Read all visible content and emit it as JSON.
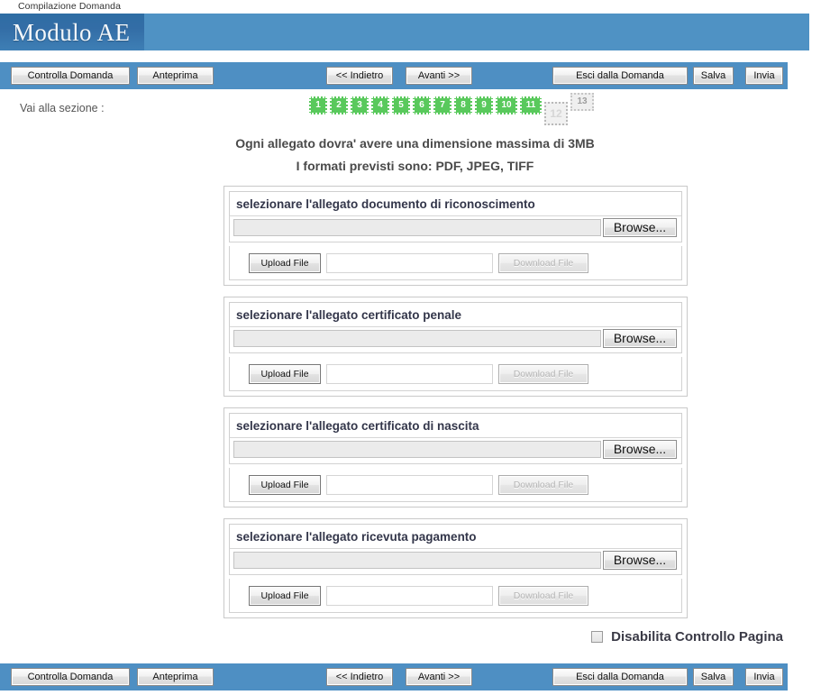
{
  "page": {
    "document_title": "Compilazione Domanda",
    "banner_title": "Modulo AE"
  },
  "toolbar": {
    "controlla_label": "Controlla Domanda",
    "anteprima_label": "Anteprima",
    "indietro_label": "<< Indietro",
    "avanti_label": "Avanti >>",
    "esci_label": "Esci dalla Domanda",
    "salva_label": "Salva",
    "invia_label": "Invia"
  },
  "section_nav": {
    "label": "Vai alla sezione :",
    "items": [
      {
        "number": "1",
        "state": "available"
      },
      {
        "number": "2",
        "state": "available"
      },
      {
        "number": "3",
        "state": "available"
      },
      {
        "number": "4",
        "state": "available"
      },
      {
        "number": "5",
        "state": "available"
      },
      {
        "number": "6",
        "state": "available"
      },
      {
        "number": "7",
        "state": "available"
      },
      {
        "number": "8",
        "state": "available"
      },
      {
        "number": "9",
        "state": "available"
      },
      {
        "number": "10",
        "state": "available"
      },
      {
        "number": "11",
        "state": "available"
      },
      {
        "number": "12",
        "state": "current"
      },
      {
        "number": "13",
        "state": "next"
      }
    ],
    "green": "#59c95c"
  },
  "info": {
    "line1": "Ogni allegato dovra' avere una dimensione massima di 3MB",
    "line2": "I formati previsti sono: PDF, JPEG, TIFF"
  },
  "common": {
    "browse_label": "Browse...",
    "upload_label": "Upload File",
    "download_label": "Download File",
    "upload_value": "",
    "file_value": ""
  },
  "panels": [
    {
      "title": "selezionare l'allegato documento di riconoscimento"
    },
    {
      "title": "selezionare l'allegato certificato penale"
    },
    {
      "title": "selezionare l'allegato certificato di nascita"
    },
    {
      "title": "selezionare l'allegato ricevuta pagamento"
    }
  ],
  "footer": {
    "disable_check_label": "Disabilita Controllo Pagina",
    "disable_check_state": "unchecked"
  }
}
